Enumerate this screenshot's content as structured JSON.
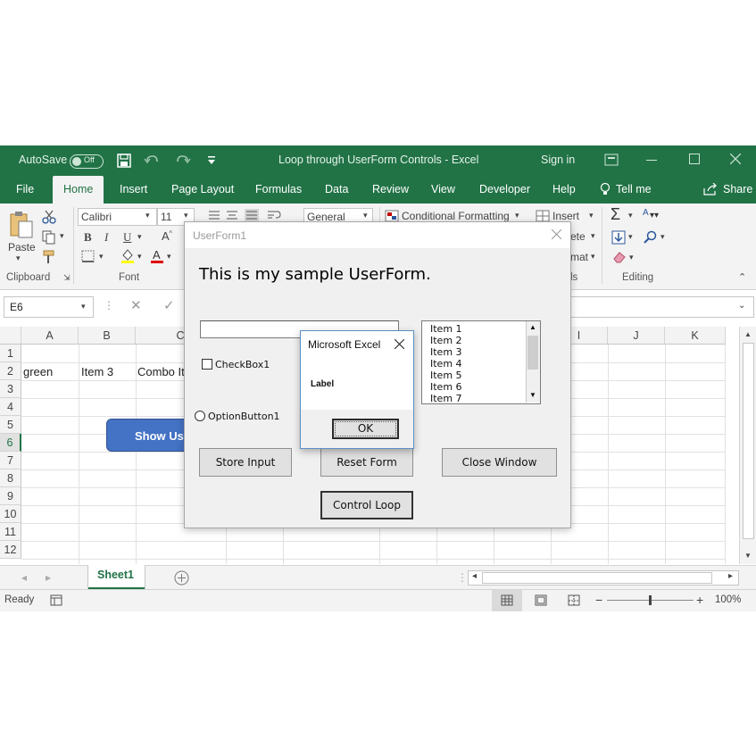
{
  "titlebar": {
    "autosave": "AutoSave",
    "toggle": "Off",
    "doc_title": "Loop through UserForm Controls  -  Excel",
    "signin": "Sign in"
  },
  "tabs": [
    "File",
    "Home",
    "Insert",
    "Page Layout",
    "Formulas",
    "Data",
    "Review",
    "View",
    "Developer",
    "Help"
  ],
  "tellme": "Tell me",
  "share": "Share",
  "ribbon": {
    "paste": "Paste",
    "font_name": "Calibri",
    "font_size": "11",
    "number_format": "General",
    "conditional_formatting": "Conditional Formatting",
    "insert": "Insert",
    "delete_partial": "ete",
    "format_partial": "mat",
    "groups": {
      "clipboard": "Clipboard",
      "font": "Font",
      "cells_partial": "ls",
      "editing": "Editing"
    }
  },
  "formula_bar": {
    "name_box": "E6"
  },
  "grid": {
    "columns": [
      "A",
      "B",
      "C",
      "I",
      "J",
      "K"
    ],
    "rows": [
      "1",
      "2",
      "3",
      "4",
      "5",
      "6",
      "7",
      "8",
      "9",
      "10",
      "11",
      "12"
    ],
    "selected_row": "6",
    "cells": {
      "A2": "green",
      "B2": "Item 3",
      "C2_partial": "Combo It"
    }
  },
  "shape_button": {
    "label": "Show Use"
  },
  "sheet_tab": "Sheet1",
  "status": {
    "ready": "Ready",
    "zoom": "100%"
  },
  "userform": {
    "title": "UserForm1",
    "heading": "This is my sample UserForm.",
    "checkbox": "CheckBox1",
    "option": "OptionButton1",
    "listbox_items": [
      "Item 1",
      "Item 2",
      "Item 3",
      "Item 4",
      "Item 5",
      "Item 6",
      "Item 7"
    ],
    "buttons": {
      "store": "Store Input",
      "reset": "Reset Form",
      "close": "Close Window",
      "loop": "Control Loop"
    }
  },
  "msgbox": {
    "title": "Microsoft Excel",
    "message": "Label",
    "ok": "OK"
  },
  "colors": {
    "excel_green": "#217346",
    "shape_blue": "#4472c4"
  }
}
